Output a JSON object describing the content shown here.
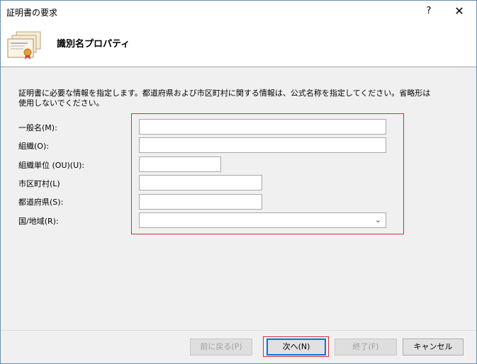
{
  "window": {
    "title": "証明書の要求",
    "help_label": "?",
    "close_label": "✕"
  },
  "header": {
    "title": "識別名プロパティ",
    "icon": "certificate-icon"
  },
  "description": "証明書に必要な情報を指定します。都道府県および市区町村に関する情報は、公式名称を指定してください。省略形は使用しないでください。",
  "form": {
    "common_name": {
      "label": "一般名(M):",
      "value": ""
    },
    "organization": {
      "label": "組織(O):",
      "value": ""
    },
    "org_unit": {
      "label": "組織単位 (OU)(U):",
      "value": ""
    },
    "city": {
      "label": "市区町村(L)",
      "value": ""
    },
    "state": {
      "label": "都道府県(S):",
      "value": ""
    },
    "country": {
      "label": "国/地域(R):",
      "value": ""
    }
  },
  "buttons": {
    "back": "前に戻る(P)",
    "next": "次へ(N)",
    "finish": "終了(F)",
    "cancel": "キャンセル"
  },
  "colors": {
    "highlight": "#d0303a",
    "focus": "#0078d7"
  }
}
